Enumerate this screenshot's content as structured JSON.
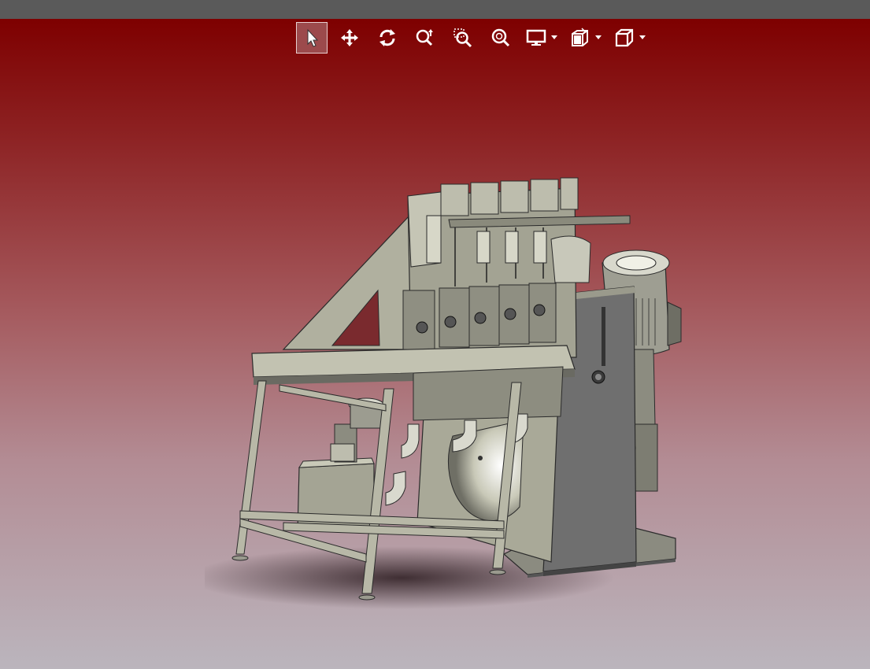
{
  "toolbar": {
    "tools": [
      {
        "name": "select",
        "icon": "select-cursor-icon",
        "active": true
      },
      {
        "name": "pan",
        "icon": "pan-move-icon"
      },
      {
        "name": "rotate",
        "icon": "rotate-icon"
      },
      {
        "name": "zoom-in-out",
        "icon": "zoom-in-out-icon"
      },
      {
        "name": "zoom-area",
        "icon": "zoom-area-icon"
      },
      {
        "name": "fit-all",
        "icon": "fit-all-icon"
      },
      {
        "name": "display-mode",
        "icon": "monitor-icon",
        "dropdown": true
      },
      {
        "name": "section-view",
        "icon": "section-cube-icon",
        "dropdown": true
      },
      {
        "name": "view-orientation",
        "icon": "iso-cube-icon",
        "dropdown": true
      }
    ]
  },
  "colors": {
    "viewport_top": "#7e0000",
    "viewport_bottom": "#bbb5bd",
    "topbar": "#5a5a5a",
    "model_body": "#a7a796",
    "model_dark": "#5f5f5f"
  }
}
